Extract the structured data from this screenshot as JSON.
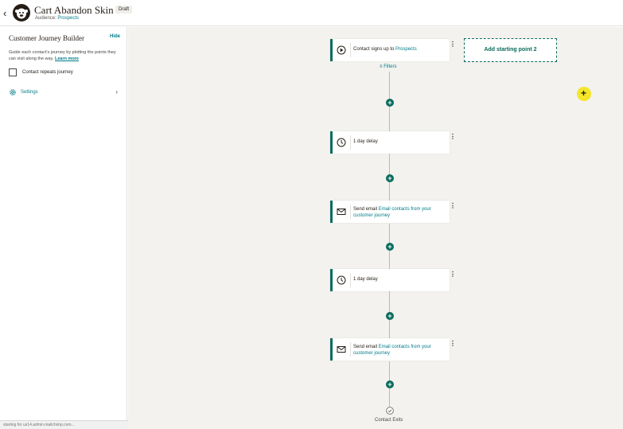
{
  "header": {
    "back_glyph": "‹",
    "title": "Cart Abandon Skin 1",
    "badge": "Draft",
    "audience_label": "Audience:",
    "audience_value": "Prospects"
  },
  "sidebar": {
    "title": "Customer Journey Builder",
    "hide_label": "Hide",
    "description": "Guide each contact's journey by plotting the points they can visit along the way.",
    "learn_more": "Learn more",
    "repeat_label": "Contact repeats journey",
    "repeat_checked": false,
    "settings_label": "Settings",
    "settings_chevron": "›"
  },
  "status_bar": {
    "text": "starting for us14.admin.mailchimp.com..."
  },
  "journey": {
    "start": {
      "icon": "play-icon",
      "text": "Contact signs up to",
      "link": "Prospects",
      "kebab": "⋮"
    },
    "add_starting_point": "Add starting point 2",
    "filters_label": "Filters",
    "filters_glyph": "≡",
    "plus_glyph": "+",
    "steps": [
      {
        "type": "delay",
        "icon": "clock-icon",
        "text": "1 day delay"
      },
      {
        "type": "email",
        "icon": "envelope-icon",
        "text": "Send email",
        "link": "Email contacts from your customer journey"
      },
      {
        "type": "delay",
        "icon": "clock-icon",
        "text": "1 day delay"
      },
      {
        "type": "email",
        "icon": "envelope-icon",
        "text": "Send email",
        "link": "Email contacts from your customer journey"
      }
    ],
    "exit_label": "Contact Exits"
  },
  "colors": {
    "accent": "#0a6c5c",
    "link": "#007c89",
    "canvas_bg": "#f3f2ef",
    "cursor_highlight": "#f3e62b"
  }
}
